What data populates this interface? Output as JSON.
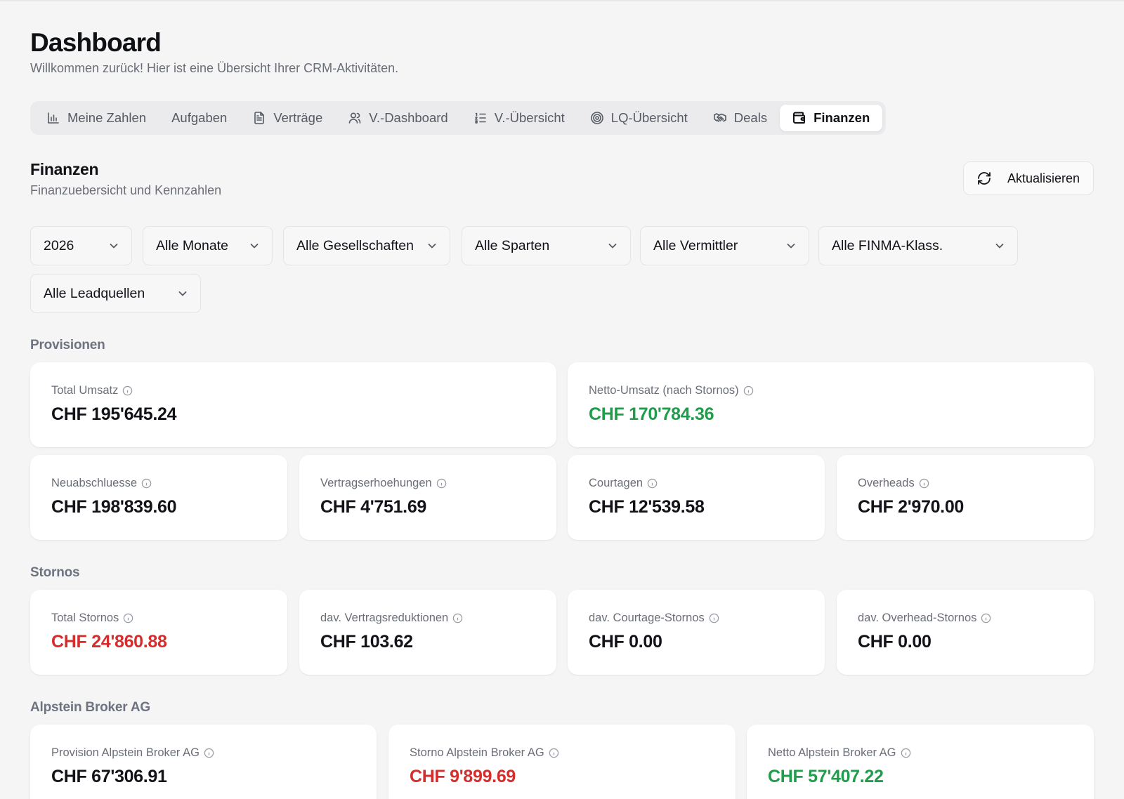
{
  "header": {
    "title": "Dashboard",
    "subtitle": "Willkommen zurück! Hier ist eine Übersicht Ihrer CRM-Aktivitäten."
  },
  "tabs": [
    {
      "label": "Meine Zahlen",
      "icon": "bar-chart-icon",
      "active": false
    },
    {
      "label": "Aufgaben",
      "icon": "",
      "active": false
    },
    {
      "label": "Verträge",
      "icon": "file-text-icon",
      "active": false
    },
    {
      "label": "V.-Dashboard",
      "icon": "users-icon",
      "active": false
    },
    {
      "label": "V.-Übersicht",
      "icon": "list-ordered-icon",
      "active": false
    },
    {
      "label": "LQ-Übersicht",
      "icon": "target-icon",
      "active": false
    },
    {
      "label": "Deals",
      "icon": "handshake-icon",
      "active": false
    },
    {
      "label": "Finanzen",
      "icon": "wallet-icon",
      "active": true
    }
  ],
  "section": {
    "title": "Finanzen",
    "subtitle": "Finanzuebersicht und Kennzahlen",
    "refresh_label": "Aktualisieren"
  },
  "filters": {
    "year": "2026",
    "month": "Alle Monate",
    "company": "Alle Gesellschaften",
    "division": "Alle Sparten",
    "broker": "Alle Vermittler",
    "finma": "Alle FINMA-Klass.",
    "leadsource": "Alle Leadquellen"
  },
  "groups": {
    "provisionen": "Provisionen",
    "stornos": "Stornos",
    "alpstein": "Alpstein Broker AG"
  },
  "cards": {
    "total_umsatz": {
      "label": "Total Umsatz",
      "value": "CHF 195'645.24"
    },
    "netto_umsatz": {
      "label": "Netto-Umsatz (nach Stornos)",
      "value": "CHF 170'784.36"
    },
    "neuabschluesse": {
      "label": "Neuabschluesse",
      "value": "CHF 198'839.60"
    },
    "vertragserhoehungen": {
      "label": "Vertragserhoehungen",
      "value": "CHF 4'751.69"
    },
    "courtagen": {
      "label": "Courtagen",
      "value": "CHF 12'539.58"
    },
    "overheads": {
      "label": "Overheads",
      "value": "CHF 2'970.00"
    },
    "total_stornos": {
      "label": "Total Stornos",
      "value": "CHF 24'860.88"
    },
    "vertragsreduktionen": {
      "label": "dav. Vertragsreduktionen",
      "value": "CHF 103.62"
    },
    "courtage_stornos": {
      "label": "dav. Courtage-Stornos",
      "value": "CHF 0.00"
    },
    "overhead_stornos": {
      "label": "dav. Overhead-Stornos",
      "value": "CHF 0.00"
    },
    "provision_alpstein": {
      "label": "Provision Alpstein Broker AG",
      "value": "CHF 67'306.91"
    },
    "storno_alpstein": {
      "label": "Storno Alpstein Broker AG",
      "value": "CHF 9'899.69"
    },
    "netto_alpstein": {
      "label": "Netto Alpstein Broker AG",
      "value": "CHF 57'407.22"
    }
  },
  "colors": {
    "positive": "#1f9d4a",
    "negative": "#d62c2c",
    "background": "#f5f5f6"
  }
}
